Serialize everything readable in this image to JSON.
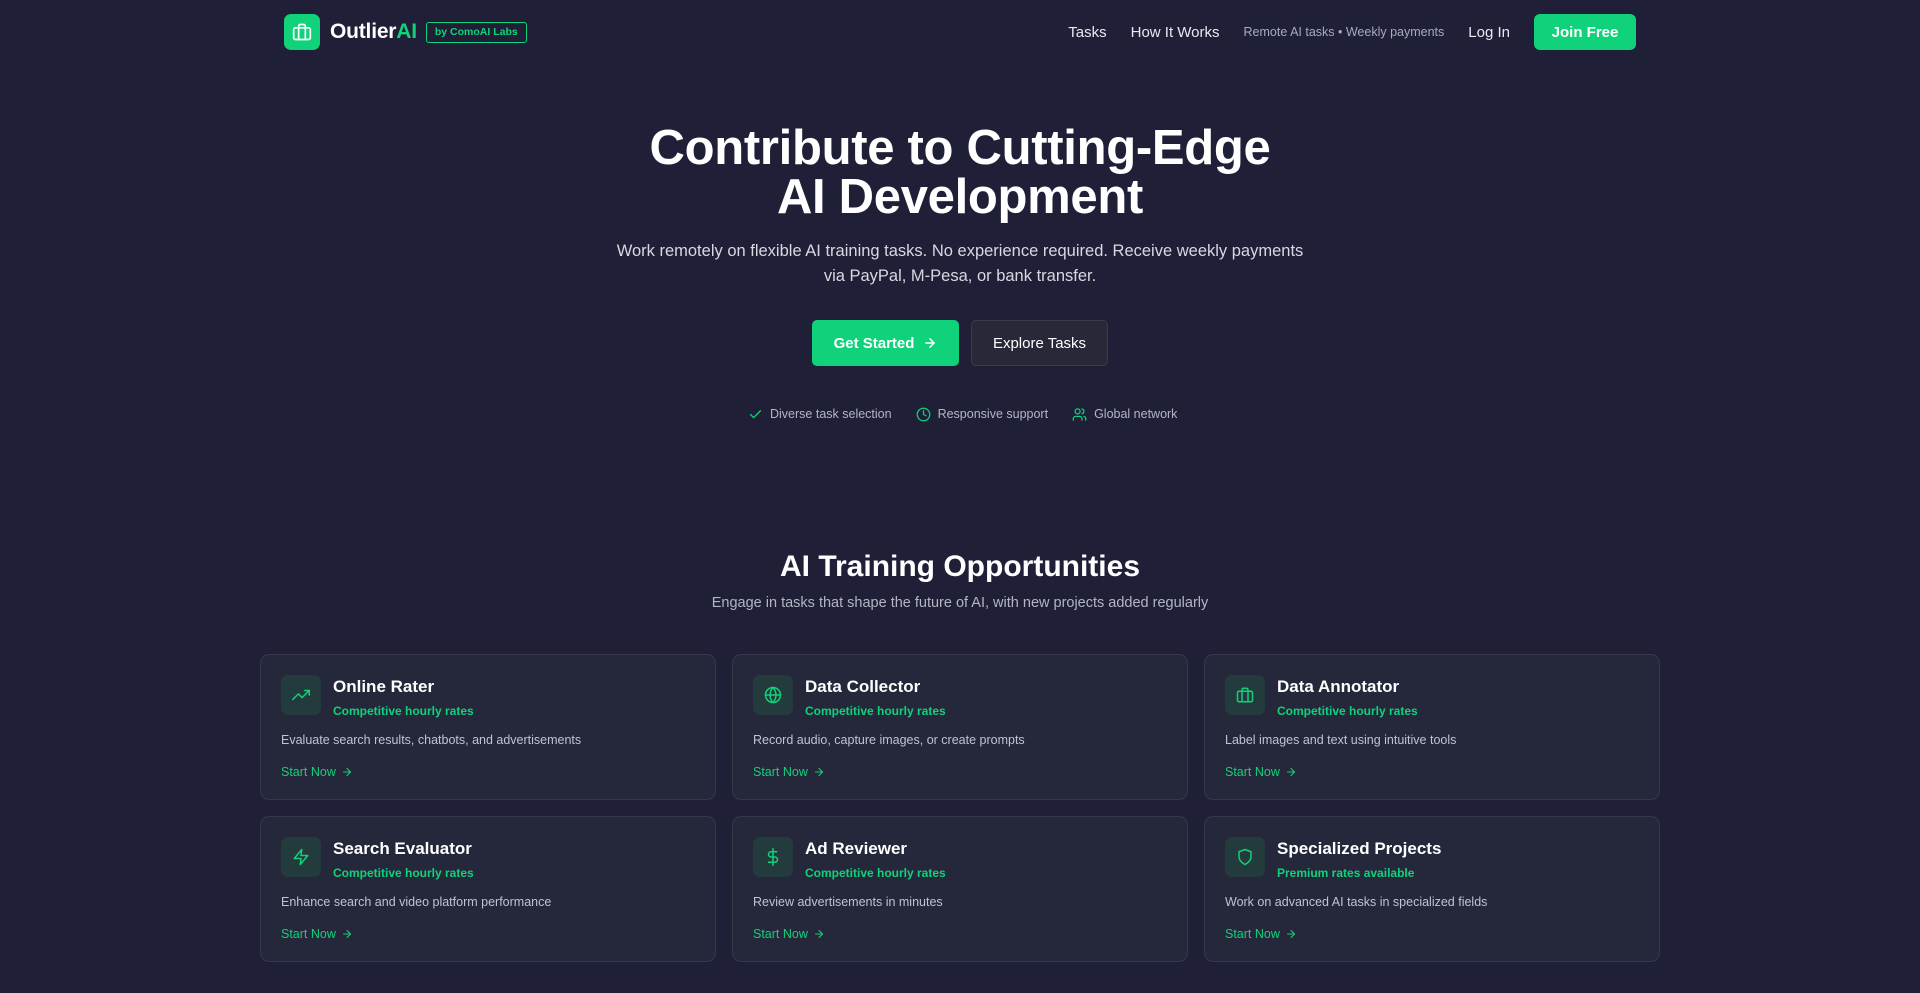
{
  "nav": {
    "brand": "Outlier",
    "brand_accent": "AI",
    "badge": "by ComoAI Labs",
    "links": [
      "Tasks",
      "How It Works"
    ],
    "tagline": "Remote AI tasks • Weekly payments",
    "login": "Log In",
    "join": "Join Free"
  },
  "hero": {
    "title_line1": "Contribute to Cutting-Edge",
    "title_line2": "AI Development",
    "subtitle_line1": "Work remotely on flexible AI training tasks. No experience required. Receive weekly payments",
    "subtitle_line2": "via PayPal, M-Pesa, or bank transfer.",
    "primary_button": "Get Started",
    "secondary_button": "Explore Tasks",
    "features": [
      {
        "icon": "check-icon",
        "label": "Diverse task selection"
      },
      {
        "icon": "clock-icon",
        "label": "Responsive support"
      },
      {
        "icon": "users-icon",
        "label": "Global network"
      }
    ]
  },
  "section": {
    "title": "AI Training Opportunities",
    "subtitle": "Engage in tasks that shape the future of AI, with new projects added regularly"
  },
  "cards": [
    {
      "icon": "trending-up-icon",
      "title": "Online Rater",
      "rate": "Competitive hourly rates",
      "desc": "Evaluate search results, chatbots, and advertisements",
      "link": "Start Now"
    },
    {
      "icon": "globe-icon",
      "title": "Data Collector",
      "rate": "Competitive hourly rates",
      "desc": "Record audio, capture images, or create prompts",
      "link": "Start Now"
    },
    {
      "icon": "briefcase-icon",
      "title": "Data Annotator",
      "rate": "Competitive hourly rates",
      "desc": "Label images and text using intuitive tools",
      "link": "Start Now"
    },
    {
      "icon": "zap-icon",
      "title": "Search Evaluator",
      "rate": "Competitive hourly rates",
      "desc": "Enhance search and video platform performance",
      "link": "Start Now"
    },
    {
      "icon": "dollar-icon",
      "title": "Ad Reviewer",
      "rate": "Competitive hourly rates",
      "desc": "Review advertisements in minutes",
      "link": "Start Now"
    },
    {
      "icon": "shield-icon",
      "title": "Specialized Projects",
      "rate": "Premium rates available",
      "desc": "Work on advanced AI tasks in specialized fields",
      "link": "Start Now"
    }
  ],
  "colors": {
    "background": "#1f2037",
    "accent": "#10d27a",
    "card": "#25273a"
  }
}
